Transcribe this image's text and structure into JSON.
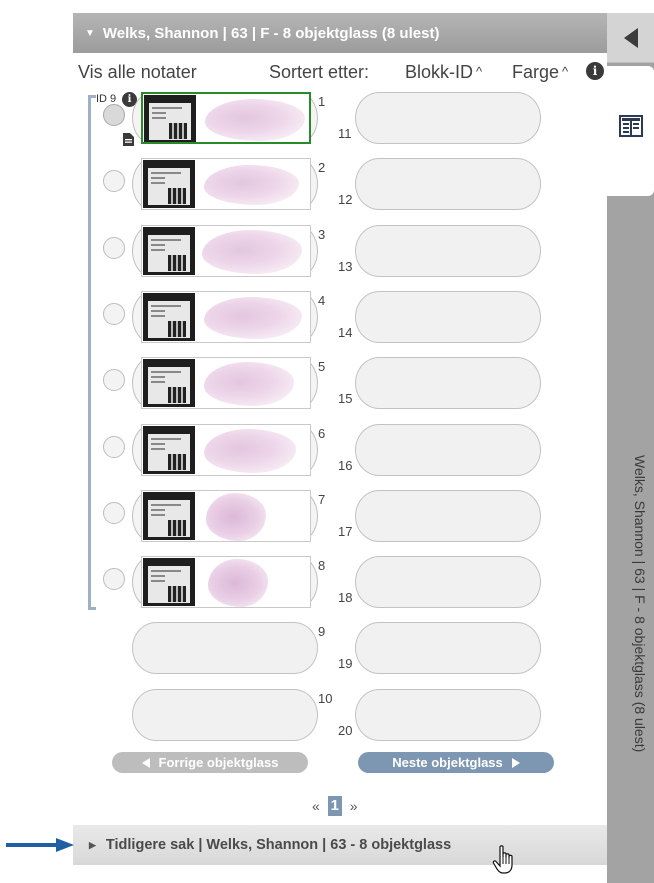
{
  "header": {
    "title": "Welks, Shannon | 63 | F - 8 objektglass (8 ulest)"
  },
  "side_panel": {
    "vertical_title": "Welks, Shannon | 63 | F - 8 objektglass (8 ulest)",
    "collapse_icon": "collapse-left-icon",
    "layout_icon": "slide-layout-icon"
  },
  "toolbar": {
    "show_notes": "Vis alle notater",
    "sort_label": "Sortert etter:",
    "sort_block": "Blokk-ID",
    "sort_color": "Farge",
    "sort_chevron": "^"
  },
  "block": {
    "id_label": "ID 9",
    "info_symbol": "i"
  },
  "slides": [
    {
      "number": "1",
      "selected": true
    },
    {
      "number": "2",
      "selected": false
    },
    {
      "number": "3",
      "selected": false
    },
    {
      "number": "4",
      "selected": false
    },
    {
      "number": "5",
      "selected": false
    },
    {
      "number": "6",
      "selected": false
    },
    {
      "number": "7",
      "selected": false
    },
    {
      "number": "8",
      "selected": false
    }
  ],
  "empty_slots": {
    "left": [
      "9",
      "10"
    ],
    "right": [
      "11",
      "12",
      "13",
      "14",
      "15",
      "16",
      "17",
      "18",
      "19",
      "20"
    ]
  },
  "navigation": {
    "prev_label": "Forrige objektglass",
    "next_label": "Neste objektglass"
  },
  "pager": {
    "prev": "«",
    "current": "1",
    "next": "»"
  },
  "previous_case": {
    "title": "Tidligere sak | Welks, Shannon | 63 - 8 objektglass"
  },
  "colors": {
    "header_bg": "#a6a6a6",
    "side_panel_bg": "#a3a3a3",
    "selected_border": "#2a8a2a",
    "next_button": "#7d97b3",
    "prev_button": "#bdbdbd",
    "annotation_arrow": "#1f5fa6"
  }
}
